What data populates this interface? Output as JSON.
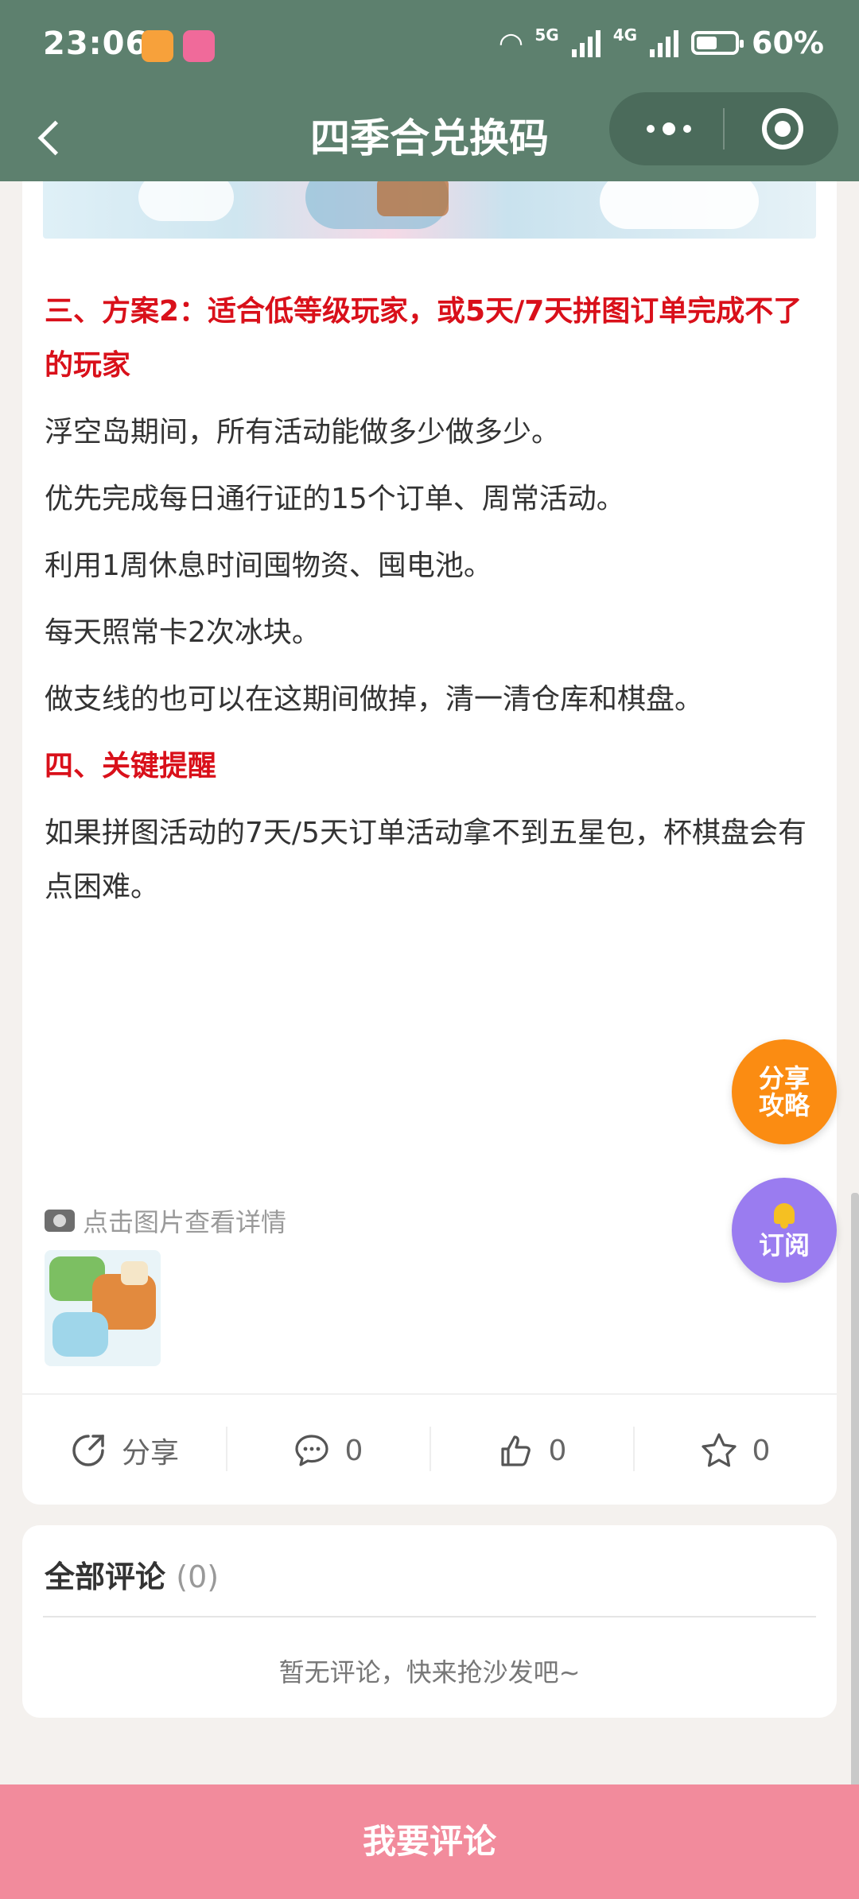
{
  "status_bar": {
    "time": "23:06",
    "net_5g": "5G",
    "net_4g": "4G",
    "battery": "60%",
    "battery_level": 0.6
  },
  "header": {
    "title": "四季合兑换码"
  },
  "article": {
    "section3_heading": "三、方案2：适合低等级玩家，或5天/7天拼图订单完成不了的玩家",
    "paragraphs_s3": [
      "浮空岛期间，所有活动能做多少做多少。",
      "优先完成每日通行证的15个订单、周常活动。",
      "利用1周休息时间囤物资、囤电池。",
      "每天照常卡2次冰块。",
      "做支线的也可以在这期间做掉，清一清仓库和棋盘。"
    ],
    "section4_heading": "四、关键提醒",
    "paragraph_s4": "如果拼图活动的7天/5天订单活动拿不到五星包，杯棋盘会有点困难。",
    "image_hint": "点击图片查看详情"
  },
  "actions": {
    "share_label": "分享",
    "comment_count": "0",
    "like_count": "0",
    "favorite_count": "0"
  },
  "comments": {
    "title": "全部评论",
    "count": "(0)",
    "empty_text": "暂无评论，快来抢沙发吧~"
  },
  "floating": {
    "share_line1": "分享",
    "share_line2": "攻略",
    "subscribe_label": "订阅"
  },
  "bottom_bar": {
    "label": "我要评论"
  },
  "colors": {
    "header_bg": "#5d806e",
    "heading_red": "#d9101a",
    "share_fab": "#fb8c12",
    "subscribe_fab": "#9a7cf0",
    "bottom_bar": "#f28b9c"
  }
}
